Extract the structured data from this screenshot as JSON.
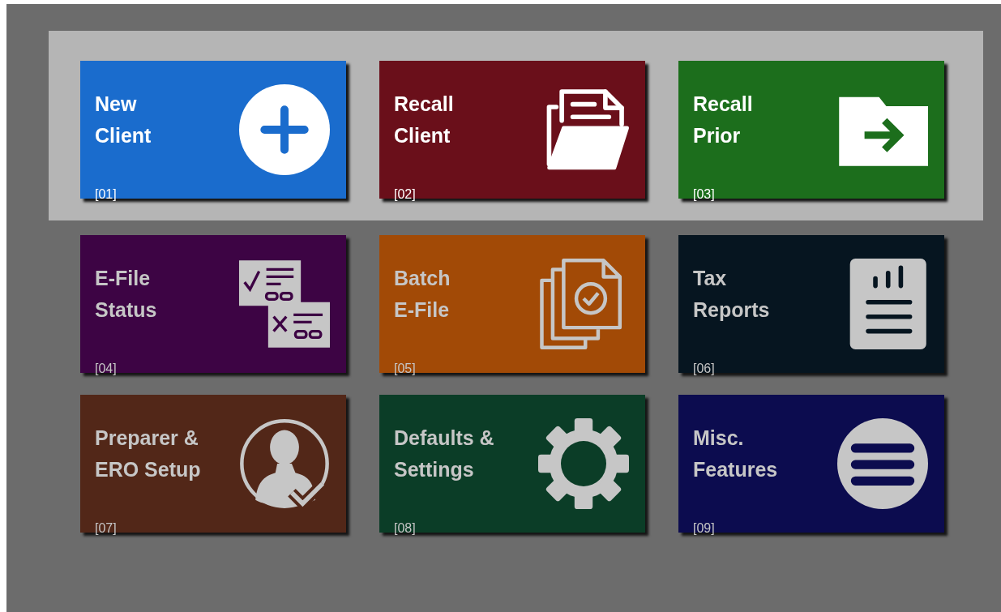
{
  "rows": [
    {
      "selected": true,
      "tiles": [
        {
          "title": "New\nClient",
          "number": "[01]",
          "color": "#1a6ccd",
          "kind": "plus"
        },
        {
          "title": "Recall\nClient",
          "number": "[02]",
          "color": "#6a0f1a",
          "kind": "open-folder"
        },
        {
          "title": "Recall\nPrior",
          "number": "[03]",
          "color": "#1c6e1c",
          "kind": "folder-arrow"
        }
      ]
    },
    {
      "selected": false,
      "tiles": [
        {
          "title": "E-File\nStatus",
          "number": "[04]",
          "color": "#3d0444",
          "kind": "forms"
        },
        {
          "title": "Batch\nE-File",
          "number": "[05]",
          "color": "#a24a06",
          "kind": "documents"
        },
        {
          "title": "Tax\nReports",
          "number": "[06]",
          "color": "#061520",
          "kind": "report"
        }
      ]
    },
    {
      "selected": false,
      "tiles": [
        {
          "title": "Preparer &\nERO Setup",
          "number": "[07]",
          "color": "#522718",
          "kind": "person"
        },
        {
          "title": "Defaults &\nSettings",
          "number": "[08]",
          "color": "#0b3d27",
          "kind": "gear"
        },
        {
          "title": "Misc.\nFeatures",
          "number": "[09]",
          "color": "#0c0c4f",
          "kind": "menu"
        }
      ]
    }
  ]
}
